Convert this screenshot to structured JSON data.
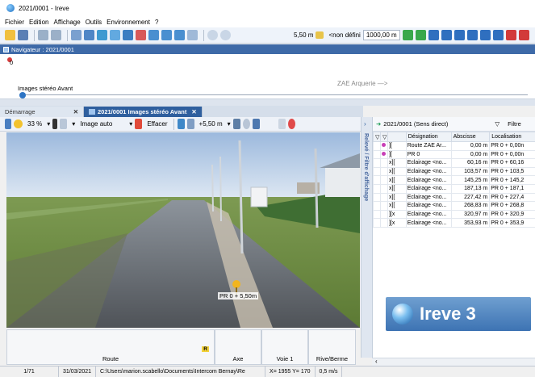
{
  "window": {
    "title": "2021/0001 - Ireve"
  },
  "menu": [
    "Fichier",
    "Edition",
    "Affichage",
    "Outils",
    "Environnement",
    "?"
  ],
  "toolbar": {
    "distance": "5,50 m",
    "profile": "<non défini",
    "scale": "1000,00 m"
  },
  "navigator": {
    "title": "Navigateur : 2021/0001",
    "zero": "0",
    "track_label": "Images stéréo Avant",
    "zone_label": "ZAE Arquerie —>"
  },
  "tabs": [
    {
      "label": "Démarrage"
    },
    {
      "label": "2021/0001  Images stéréo Avant"
    }
  ],
  "image_toolbar": {
    "zoom": "33 %",
    "mode": "Image auto",
    "erase": "Effacer",
    "offset": "+5,50 m"
  },
  "scene": {
    "pin_label": "PR 0 + 5,50m"
  },
  "side_label": "Relevé / Filtre d'affichage",
  "right_panel": {
    "header": "2021/0001 (Sens direct)",
    "filter": "Filtre",
    "columns": [
      "Désignation",
      "Abscisse",
      "Localisation"
    ],
    "rows": [
      {
        "flag": "][",
        "designation": "Route ZAE Ar...",
        "abscisse": "0,00 m",
        "loc": "PR 0 + 0,00n"
      },
      {
        "flag": "][",
        "designation": "PR 0",
        "abscisse": "0,00 m",
        "loc": "PR 0 + 0,00n"
      },
      {
        "flag": "x][",
        "designation": "Eclairage <no...",
        "abscisse": "60,16 m",
        "loc": "PR 0 + 60,16"
      },
      {
        "flag": "x][",
        "designation": "Eclairage <no...",
        "abscisse": "103,57 m",
        "loc": "PR 0 + 103,5"
      },
      {
        "flag": "x][",
        "designation": "Eclairage <no...",
        "abscisse": "145,25 m",
        "loc": "PR 0 + 145,2"
      },
      {
        "flag": "x][",
        "designation": "Eclairage <no...",
        "abscisse": "187,13 m",
        "loc": "PR 0 + 187,1"
      },
      {
        "flag": "x][",
        "designation": "Eclairage <no...",
        "abscisse": "227,42 m",
        "loc": "PR 0 + 227,4"
      },
      {
        "flag": "x][",
        "designation": "Eclairage <no...",
        "abscisse": "268,83 m",
        "loc": "PR 0 + 268,8"
      },
      {
        "flag": "][x",
        "designation": "Eclairage <no...",
        "abscisse": "320,97 m",
        "loc": "PR 0 + 320,9"
      },
      {
        "flag": "][x",
        "designation": "Eclairage <no...",
        "abscisse": "353,93 m",
        "loc": "PR 0 + 353,9"
      }
    ]
  },
  "logo": {
    "text": "Ireve 3"
  },
  "info_panel": {
    "route_label": "Route",
    "badge": "R",
    "axe_label": "Axe",
    "voie_label": "Voie 1",
    "rive_label": "Rive/Berme"
  },
  "status": {
    "page": "1/71",
    "date": "31/03/2021",
    "path": "C:\\Users\\marion.scabello\\Documents\\Intercom Bernay\\Re",
    "coords": "X= 1955 Y= 170",
    "speed": "0,5 m/s"
  },
  "colors": {
    "accent": "#2f5f9e",
    "pin": "#f2b51f",
    "purple": "#c83fb7"
  }
}
